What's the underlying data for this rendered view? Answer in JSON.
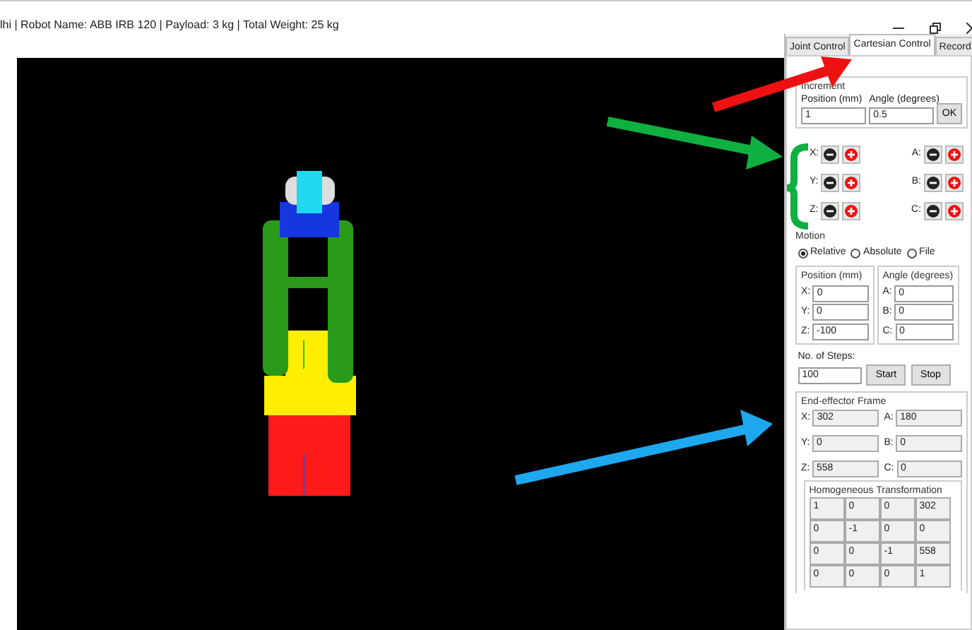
{
  "window": {
    "title": "lhi | Robot Name: ABB IRB 120 | Payload: 3 kg | Total Weight: 25 kg"
  },
  "tabs": [
    {
      "label": "Joint Control",
      "selected": false
    },
    {
      "label": "Cartesian Control",
      "selected": true
    },
    {
      "label": "Record",
      "selected": false
    }
  ],
  "increment": {
    "title": "Increment",
    "position_label": "Position (mm)",
    "position_value": "1",
    "angle_label": "Angle (degrees)",
    "angle_value": "0.5",
    "button": "OK"
  },
  "jog": [
    {
      "left": "X:",
      "right": "A:"
    },
    {
      "left": "Y:",
      "right": "B:"
    },
    {
      "left": "Z:",
      "right": "C:"
    }
  ],
  "motion": {
    "title": "Motion",
    "options": [
      {
        "label": "Relative",
        "selected": true
      },
      {
        "label": "Absolute",
        "selected": false
      },
      {
        "label": "File",
        "selected": false
      }
    ]
  },
  "position": {
    "title": "Position (mm)",
    "fields": [
      {
        "label": "X:",
        "value": "0"
      },
      {
        "label": "Y:",
        "value": "0"
      },
      {
        "label": "Z:",
        "value": "-100"
      }
    ]
  },
  "angle": {
    "title": "Angle (degrees)",
    "fields": [
      {
        "label": "A:",
        "value": "0"
      },
      {
        "label": "B:",
        "value": "0"
      },
      {
        "label": "C:",
        "value": "0"
      }
    ]
  },
  "steps": {
    "label": "No. of Steps:",
    "value": "100",
    "buttons": [
      "Start",
      "Stop"
    ]
  },
  "end_effector": {
    "title": "End-effector Frame",
    "rows": [
      [
        {
          "label": "X:",
          "value": "302"
        },
        {
          "label": "A:",
          "value": "180"
        }
      ],
      [
        {
          "label": "Y:",
          "value": "0"
        },
        {
          "label": "B:",
          "value": "0"
        }
      ],
      [
        {
          "label": "Z:",
          "value": "558"
        },
        {
          "label": "C:",
          "value": "0"
        }
      ]
    ]
  },
  "transform": {
    "title": "Homogeneous Transformation",
    "rows": [
      [
        "1",
        "0",
        "0",
        "302"
      ],
      [
        "0",
        "-1",
        "0",
        "0"
      ],
      [
        "0",
        "0",
        "-1",
        "558"
      ],
      [
        "0",
        "0",
        "0",
        "1"
      ]
    ]
  }
}
